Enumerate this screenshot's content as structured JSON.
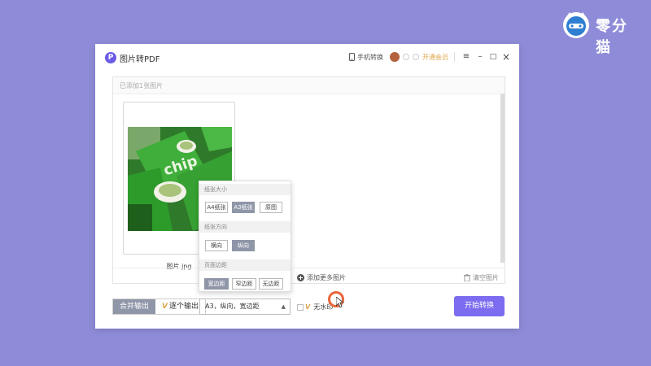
{
  "brand": {
    "name": "零分猫"
  },
  "window": {
    "title": "图片转PDF",
    "logo_letter": "P",
    "phone_convert": "手机转换",
    "vip": "开通会员",
    "menu": "≡",
    "minimize": "–",
    "maximize": "□",
    "close": "×"
  },
  "panel": {
    "count_text": "已添加1张图片",
    "image_name": "图片.jpg",
    "add_more": "添加更多图片",
    "clear": "清空图片"
  },
  "bottom": {
    "merge_output": "合并输出",
    "single_output": "逐个输出",
    "single_output_vip": "V",
    "settings_value": "A3，纵向，宽边距",
    "watermark_vip": "V",
    "watermark_label": "无水印",
    "start": "开始转换"
  },
  "popover": {
    "paper_size_label": "纸张大小",
    "paper_sizes": [
      "A4纸张",
      "A3纸张",
      "原图"
    ],
    "paper_size_selected": "A3纸张",
    "orientation_label": "纸张方向",
    "orientations": [
      "横向",
      "纵向"
    ],
    "orientation_selected": "纵向",
    "margin_label": "页面边距",
    "margins": [
      "宽边距",
      "窄边距",
      "无边距"
    ],
    "margin_selected": "宽边距"
  },
  "colors": {
    "background": "#8e8cd8",
    "accent": "#7b6cf0",
    "selected": "#8f96a8",
    "vip": "#e0a64a"
  }
}
